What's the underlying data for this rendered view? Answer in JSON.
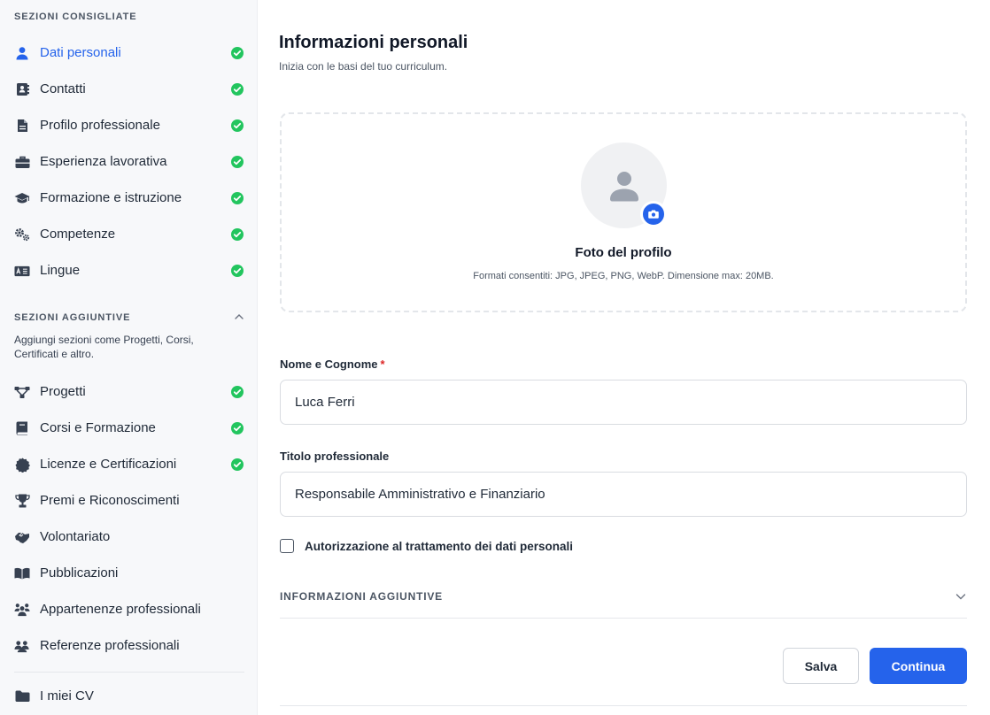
{
  "sidebar": {
    "recommended_header": "SEZIONI CONSIGLIATE",
    "recommended": [
      {
        "label": "Dati personali",
        "icon": "user-icon",
        "done": true,
        "active": true
      },
      {
        "label": "Contatti",
        "icon": "address-book-icon",
        "done": true
      },
      {
        "label": "Profilo professionale",
        "icon": "file-icon",
        "done": true
      },
      {
        "label": "Esperienza lavorativa",
        "icon": "briefcase-icon",
        "done": true
      },
      {
        "label": "Formazione e istruzione",
        "icon": "graduation-cap-icon",
        "done": true
      },
      {
        "label": "Competenze",
        "icon": "gears-icon",
        "done": true
      },
      {
        "label": "Lingue",
        "icon": "language-icon",
        "done": true
      }
    ],
    "additional_header": "SEZIONI AGGIUNTIVE",
    "additional_desc": "Aggiungi sezioni come Progetti, Corsi, Certificati e altro.",
    "additional": [
      {
        "label": "Progetti",
        "icon": "diagram-icon",
        "done": true
      },
      {
        "label": "Corsi e Formazione",
        "icon": "book-icon",
        "done": true
      },
      {
        "label": "Licenze e Certificazioni",
        "icon": "certificate-icon",
        "done": true
      },
      {
        "label": "Premi e Riconoscimenti",
        "icon": "trophy-icon",
        "done": false
      },
      {
        "label": "Volontariato",
        "icon": "handshake-icon",
        "done": false
      },
      {
        "label": "Pubblicazioni",
        "icon": "open-book-icon",
        "done": false
      },
      {
        "label": "Appartenenze professionali",
        "icon": "people-group-icon",
        "done": false
      },
      {
        "label": "Referenze professionali",
        "icon": "users-icon",
        "done": false
      }
    ],
    "my_cvs": {
      "label": "I miei CV",
      "icon": "folder-icon"
    }
  },
  "main": {
    "title": "Informazioni personali",
    "subtitle": "Inizia con le basi del tuo curriculum.",
    "photo": {
      "title": "Foto del profilo",
      "hint": "Formati consentiti: JPG, JPEG, PNG, WebP. Dimensione max: 20MB."
    },
    "name_field": {
      "label": "Nome e Cognome",
      "required_mark": "*",
      "value": "Luca Ferri"
    },
    "title_field": {
      "label": "Titolo professionale",
      "value": "Responsabile Amministrativo e Finanziario"
    },
    "consent_label": "Autorizzazione al trattamento dei dati personali",
    "additional_info_label": "INFORMAZIONI AGGIUNTIVE",
    "save_label": "Salva",
    "continue_label": "Continua"
  },
  "colors": {
    "accent": "#2563eb",
    "check": "#22c55e",
    "required": "#dc2626"
  }
}
